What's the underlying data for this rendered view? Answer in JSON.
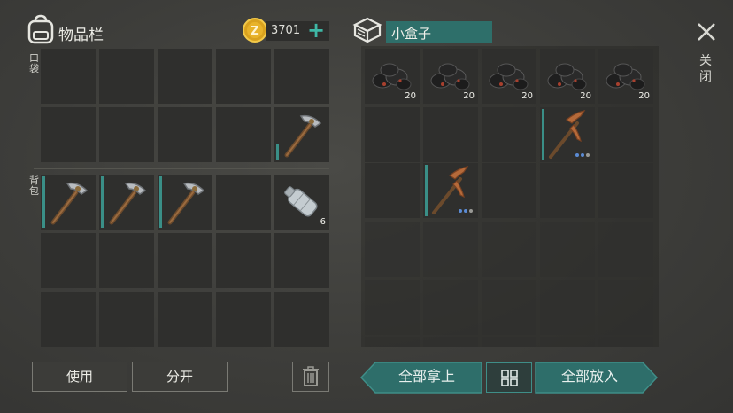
{
  "inventory": {
    "title": "物品栏",
    "coins": "3701",
    "pocket_label": "口袋",
    "backpack_label": "背包",
    "slots": {
      "water_bottle_count": "6"
    },
    "buttons": {
      "use": "使用",
      "split": "分开"
    }
  },
  "container": {
    "title": "小盒子",
    "coal_count": "20",
    "buttons": {
      "take_all": "全部拿上",
      "put_all": "全部放入"
    }
  },
  "close_label": "关闭",
  "colors": {
    "accent": "#2e6e6a",
    "plus": "#3fb8a6",
    "slot": "#2f2f2d",
    "background": "#3d3d3a"
  }
}
